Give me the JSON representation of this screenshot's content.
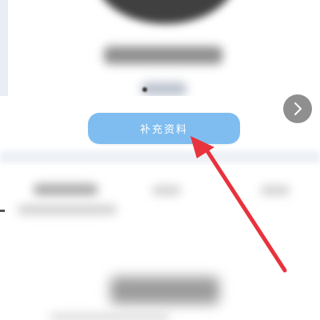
{
  "profile": {
    "action_button_label": "补充资料"
  },
  "icons": {
    "next": "chevron-right-icon",
    "pointer": "red-arrow-annotation"
  },
  "colors": {
    "button_bg": "#7fbdf0",
    "button_text": "#ffffff",
    "arrow": "#e8323c",
    "next_button_bg": "#646464"
  }
}
